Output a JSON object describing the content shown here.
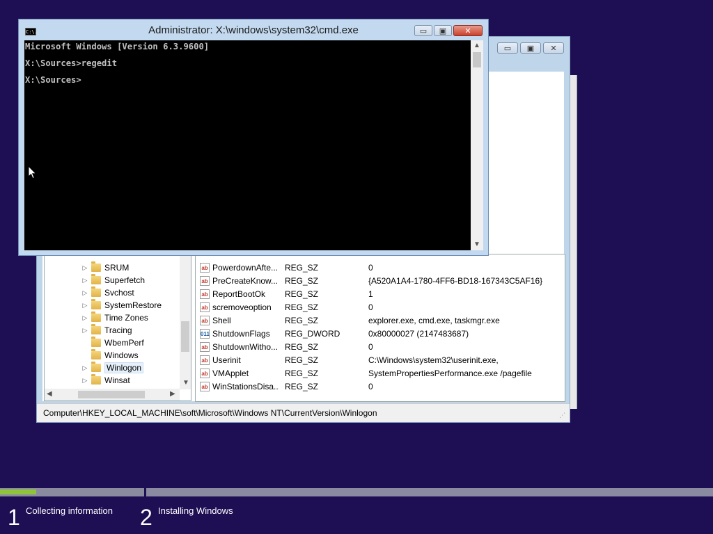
{
  "cmd": {
    "title": "Administrator: X:\\windows\\system32\\cmd.exe",
    "icon_text": "C:\\.",
    "close_glyph": "✕",
    "minimize_glyph": "▭",
    "maximize_glyph": "▣",
    "lines": [
      "Microsoft Windows [Version 6.3.9600]",
      "",
      "X:\\Sources>regedit",
      "",
      "X:\\Sources>"
    ]
  },
  "regedit": {
    "minimize_glyph": "▭",
    "maximize_glyph": "▣",
    "close_glyph": "✕",
    "tree": [
      {
        "label": "SRUM",
        "expandable": true,
        "selected": false
      },
      {
        "label": "Superfetch",
        "expandable": true,
        "selected": false
      },
      {
        "label": "Svchost",
        "expandable": true,
        "selected": false
      },
      {
        "label": "SystemRestore",
        "expandable": true,
        "selected": false
      },
      {
        "label": "Time Zones",
        "expandable": true,
        "selected": false
      },
      {
        "label": "Tracing",
        "expandable": true,
        "selected": false
      },
      {
        "label": "WbemPerf",
        "expandable": false,
        "selected": false
      },
      {
        "label": "Windows",
        "expandable": false,
        "selected": false
      },
      {
        "label": "Winlogon",
        "expandable": true,
        "selected": true
      },
      {
        "label": "Winsat",
        "expandable": true,
        "selected": false
      }
    ],
    "values": [
      {
        "name": "PowerdownAfte...",
        "type": "REG_SZ",
        "data": "0",
        "kind": "sz"
      },
      {
        "name": "PreCreateKnow...",
        "type": "REG_SZ",
        "data": "{A520A1A4-1780-4FF6-BD18-167343C5AF16}",
        "kind": "sz"
      },
      {
        "name": "ReportBootOk",
        "type": "REG_SZ",
        "data": "1",
        "kind": "sz"
      },
      {
        "name": "scremoveoption",
        "type": "REG_SZ",
        "data": "0",
        "kind": "sz"
      },
      {
        "name": "Shell",
        "type": "REG_SZ",
        "data": "explorer.exe, cmd.exe, taskmgr.exe",
        "kind": "sz"
      },
      {
        "name": "ShutdownFlags",
        "type": "REG_DWORD",
        "data": "0x80000027 (2147483687)",
        "kind": "dword"
      },
      {
        "name": "ShutdownWitho...",
        "type": "REG_SZ",
        "data": "0",
        "kind": "sz"
      },
      {
        "name": "Userinit",
        "type": "REG_SZ",
        "data": "C:\\Windows\\system32\\userinit.exe,",
        "kind": "sz"
      },
      {
        "name": "VMApplet",
        "type": "REG_SZ",
        "data": "SystemPropertiesPerformance.exe /pagefile",
        "kind": "sz"
      },
      {
        "name": "WinStationsDisa...",
        "type": "REG_SZ",
        "data": "0",
        "kind": "sz"
      }
    ],
    "status_path": "Computer\\HKEY_LOCAL_MACHINE\\soft\\Microsoft\\Windows NT\\CurrentVersion\\Winlogon"
  },
  "setup": {
    "stage1": {
      "number": "1",
      "label": "Collecting information",
      "progress": 0.25
    },
    "stage2": {
      "number": "2",
      "label": "Installing Windows"
    }
  },
  "colors": {
    "background": "#1e0e54",
    "progress_fill": "#8fc43a"
  }
}
